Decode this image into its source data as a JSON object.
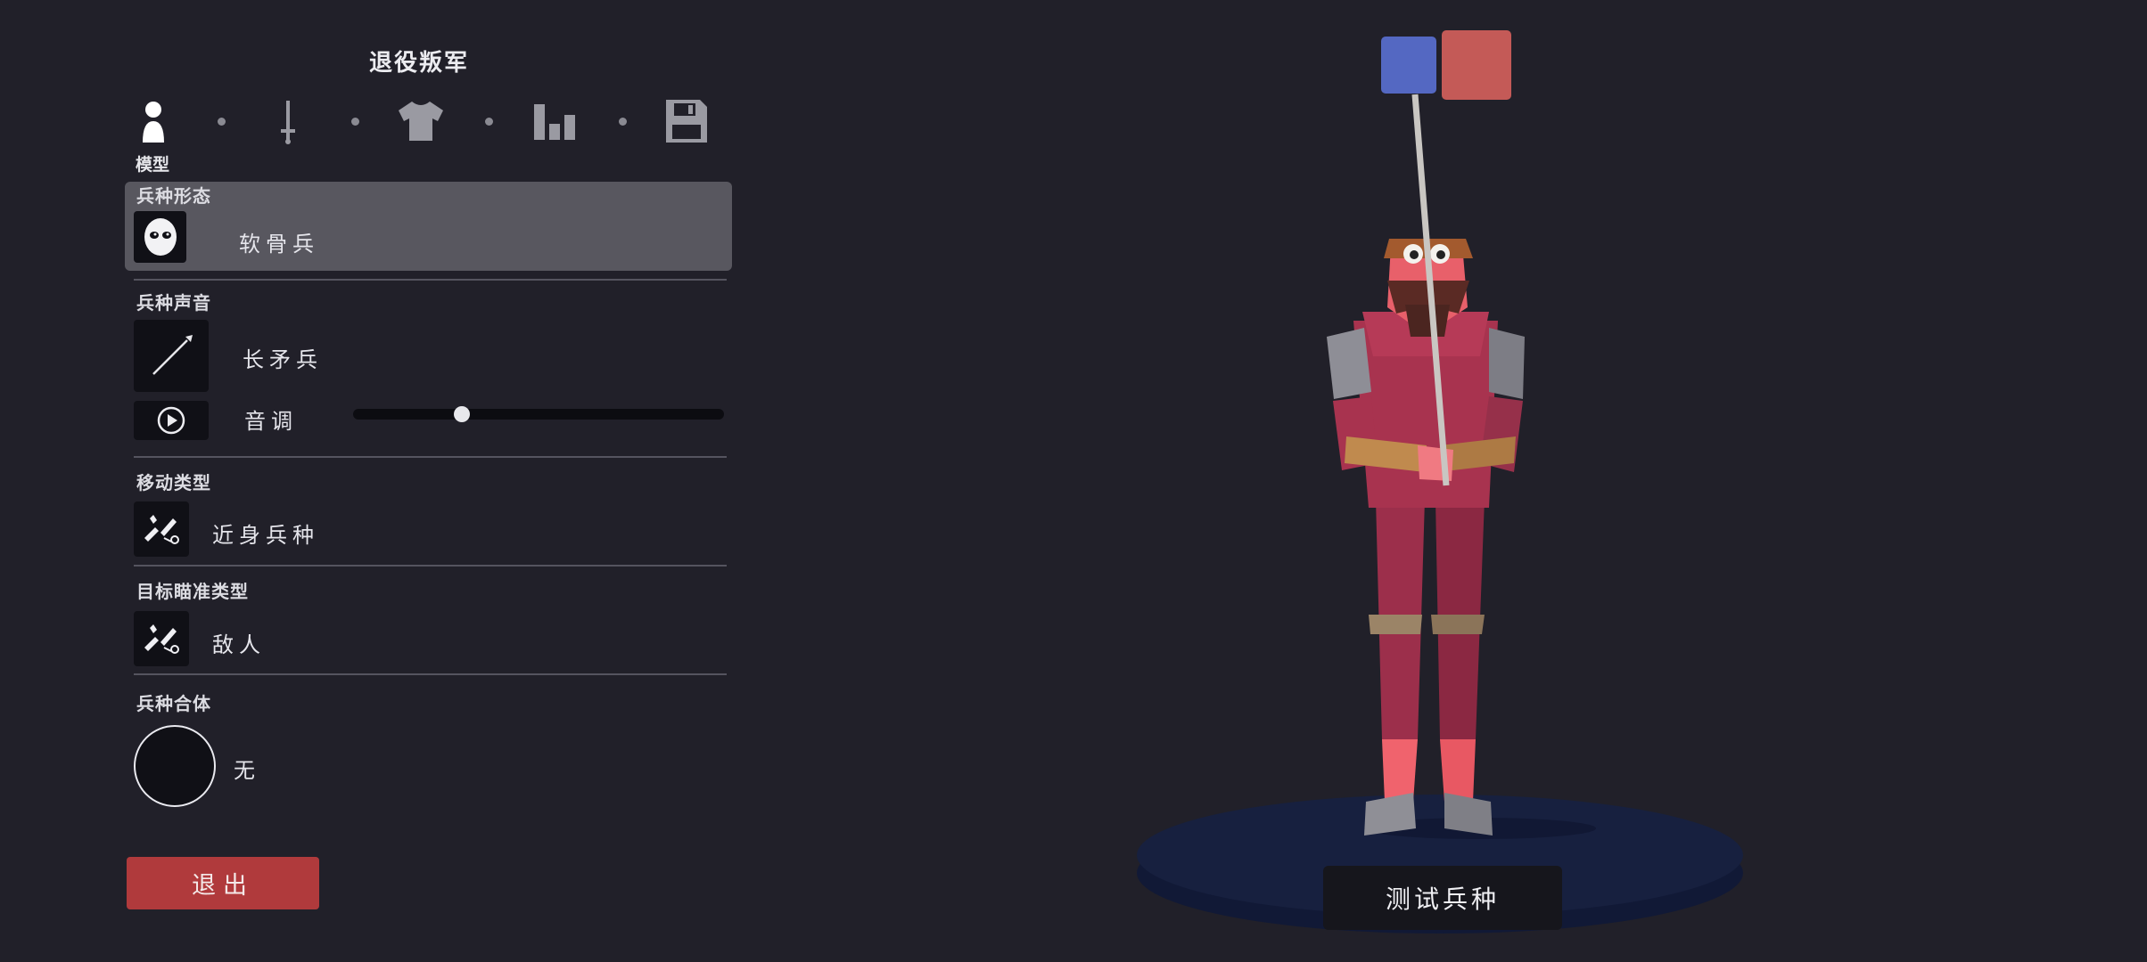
{
  "header": {
    "title": "退役叛军"
  },
  "steps": {
    "items": [
      {
        "icon": "person-icon",
        "label": "模型",
        "active": true
      },
      {
        "icon": "sword-icon",
        "active": false
      },
      {
        "icon": "shirt-icon",
        "active": false
      },
      {
        "icon": "stats-icon",
        "active": false
      },
      {
        "icon": "save-icon",
        "active": false
      }
    ]
  },
  "unit_form": {
    "label": "兵种形态",
    "value": "软骨兵",
    "icon": "mask-face-icon"
  },
  "unit_voice": {
    "label": "兵种声音",
    "value": "长矛兵",
    "icon": "spear-icon",
    "pitch_label": "音调",
    "pitch_value": 0.29,
    "play_icon": "play-icon"
  },
  "movement": {
    "label": "移动类型",
    "value": "近身兵种",
    "icon": "melee-unit-icon"
  },
  "targeting": {
    "label": "目标瞄准类型",
    "value": "敌人",
    "icon": "target-unit-icon"
  },
  "combine": {
    "label": "兵种合体",
    "value": "无"
  },
  "buttons": {
    "exit": "退出",
    "test_unit": "测试兵种"
  },
  "colors": {
    "background": "#212029",
    "team_blue": "#5468c2",
    "team_red": "#c45a57",
    "exit_button": "#b03a3c",
    "panel_highlight": "#58575f",
    "platform": "#17203f"
  }
}
